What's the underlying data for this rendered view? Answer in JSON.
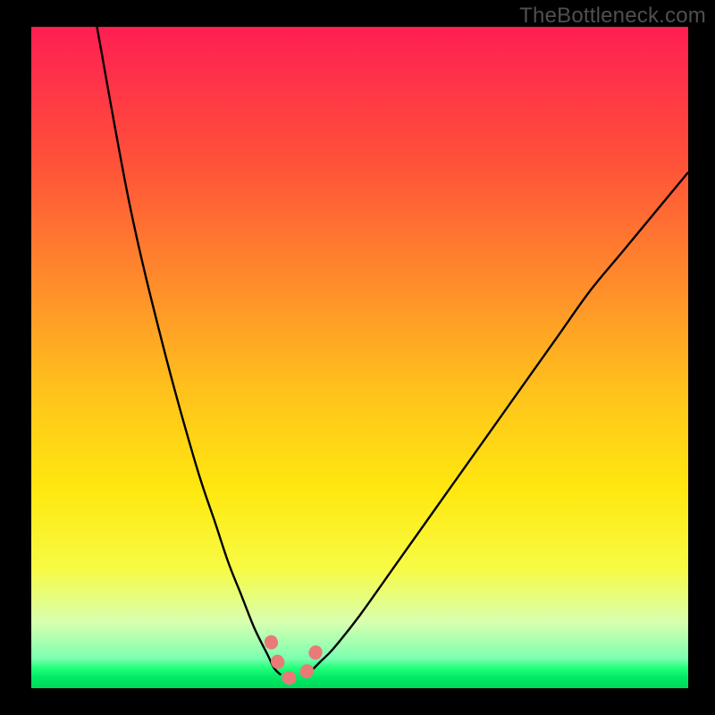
{
  "watermark": "TheBottleneck.com",
  "chart_data": {
    "type": "line",
    "title": "",
    "xlabel": "",
    "ylabel": "",
    "xlim": [
      0,
      100
    ],
    "ylim": [
      0,
      100
    ],
    "grid": false,
    "notes": "Two curved black series forming a V that bottoms near x≈38-40. Vertical gradient background red→yellow→green (top→bottom) with a thin bright-green strip at the very bottom. A short salmon/pink marker band traces the V bottom.",
    "series": [
      {
        "name": "left-curve",
        "x": [
          10,
          15,
          20,
          25,
          28,
          30,
          32,
          34,
          36,
          37,
          38
        ],
        "y": [
          100,
          73,
          52,
          34,
          25,
          19,
          14,
          9,
          5,
          3,
          2
        ]
      },
      {
        "name": "right-curve",
        "x": [
          42,
          44,
          46,
          50,
          55,
          60,
          65,
          70,
          75,
          80,
          85,
          90,
          95,
          100
        ],
        "y": [
          2,
          4,
          6,
          11,
          18,
          25,
          32,
          39,
          46,
          53,
          60,
          66,
          72,
          78
        ]
      },
      {
        "name": "bottom-marker",
        "x": [
          36.5,
          37.5,
          38.5,
          39.5,
          40.5,
          41.5,
          42.5,
          43.5
        ],
        "y": [
          7,
          4,
          2,
          1.5,
          1.5,
          2,
          3.5,
          6
        ]
      }
    ],
    "background_gradient_stops": [
      {
        "pos": 0.0,
        "color": "#ff1e53"
      },
      {
        "pos": 0.2,
        "color": "#ff5039"
      },
      {
        "pos": 0.4,
        "color": "#ff902a"
      },
      {
        "pos": 0.55,
        "color": "#ffc21c"
      },
      {
        "pos": 0.7,
        "color": "#ffe80f"
      },
      {
        "pos": 0.82,
        "color": "#f7fb45"
      },
      {
        "pos": 0.9,
        "color": "#d8ffb0"
      },
      {
        "pos": 0.955,
        "color": "#7cffb0"
      },
      {
        "pos": 0.97,
        "color": "#20ff78"
      },
      {
        "pos": 0.985,
        "color": "#00e864"
      },
      {
        "pos": 1.0,
        "color": "#00d85a"
      }
    ]
  }
}
